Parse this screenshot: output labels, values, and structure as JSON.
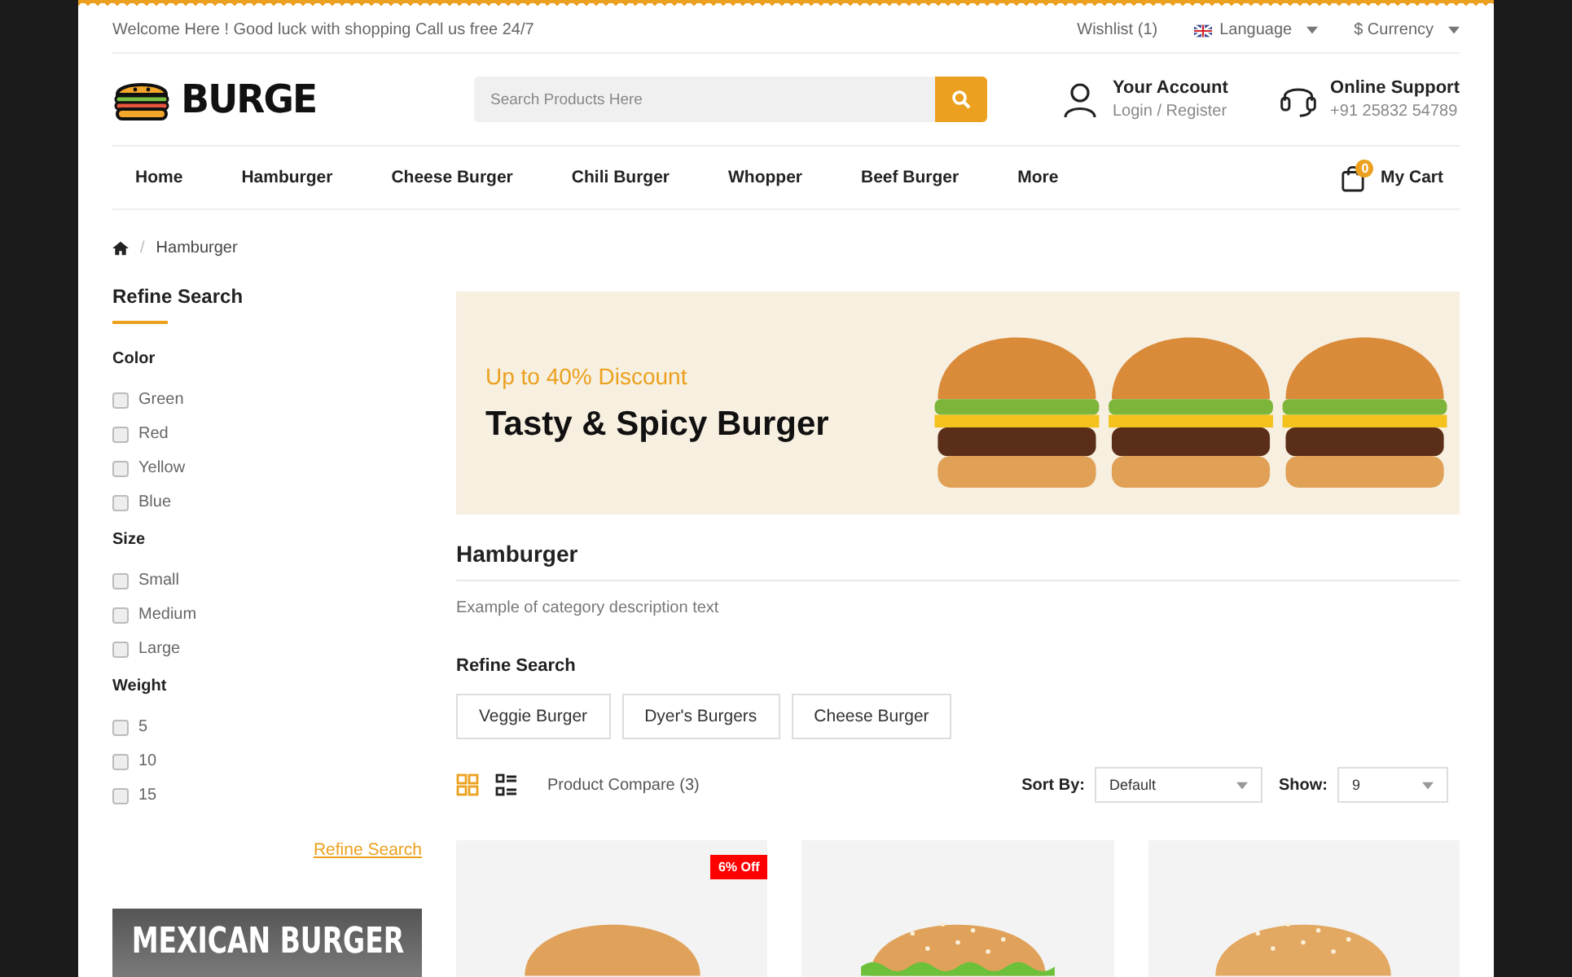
{
  "topbar": {
    "welcome": "Welcome Here ! Good luck with shopping Call us free 24/7",
    "wishlist": "Wishlist (1)",
    "language": "Language",
    "currency": "$ Currency"
  },
  "header": {
    "logo": "BURGE",
    "search": {
      "placeholder": "Search Products Here"
    },
    "account": {
      "title": "Your Account",
      "subtitle": "Login / Register"
    },
    "support": {
      "title": "Online Support",
      "phone": "+91 25832 54789"
    }
  },
  "nav": {
    "items": [
      "Home",
      "Hamburger",
      "Cheese Burger",
      "Chili Burger",
      "Whopper",
      "Beef Burger",
      "More"
    ],
    "cart": {
      "count": "0",
      "label": "My Cart"
    }
  },
  "breadcrumb": {
    "separator": "/",
    "items": [
      "Hamburger"
    ]
  },
  "sidebar": {
    "title": "Refine Search",
    "groups": [
      {
        "name": "Color",
        "options": [
          {
            "label": "Green",
            "checked": false
          },
          {
            "label": "Red",
            "checked": false
          },
          {
            "label": "Yellow",
            "checked": false
          },
          {
            "label": "Blue",
            "checked": false
          }
        ]
      },
      {
        "name": "Size",
        "options": [
          {
            "label": "Small",
            "checked": false
          },
          {
            "label": "Medium",
            "checked": false
          },
          {
            "label": "Large",
            "checked": false
          }
        ]
      },
      {
        "name": "Weight",
        "options": [
          {
            "label": "5",
            "checked": false
          },
          {
            "label": "10",
            "checked": false
          },
          {
            "label": "15",
            "checked": false
          }
        ]
      }
    ],
    "link": "Refine Search",
    "promo": "MEXICAN BURGER"
  },
  "banner": {
    "discount": "Up to 40% Discount",
    "title": "Tasty & Spicy Burger"
  },
  "category": {
    "title": "Hamburger",
    "description": "Example of category description text"
  },
  "refine": {
    "title": "Refine Search",
    "tags": [
      "Veggie Burger",
      "Dyer's Burgers",
      "Cheese Burger"
    ]
  },
  "toolbar": {
    "views": [
      {
        "kind": "grid",
        "selected": true
      },
      {
        "kind": "list",
        "selected": false
      }
    ],
    "compare": "Product Compare (3)",
    "sort_label": "Sort By:",
    "sort_value": "Default",
    "show_label": "Show:",
    "show_value": "9"
  },
  "products": [
    {
      "badge": "6% Off",
      "kind": "plain"
    },
    {
      "kind": "lettuce"
    },
    {
      "kind": "sesame"
    }
  ]
}
